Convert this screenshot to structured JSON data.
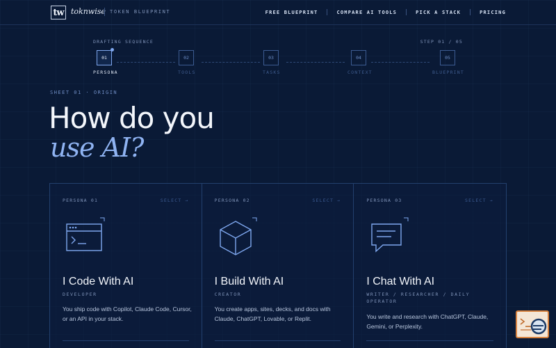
{
  "header": {
    "logo": "tw",
    "brand": "toknwise",
    "subtitle": "TOKEN BLUEPRINT",
    "nav": [
      "FREE BLUEPRINT",
      "COMPARE AI TOOLS",
      "PICK A STACK",
      "PRICING"
    ]
  },
  "stepper": {
    "label": "DRAFTING SEQUENCE",
    "count": "STEP 01 / 05",
    "steps": [
      {
        "num": "01",
        "label": "PERSONA"
      },
      {
        "num": "02",
        "label": "TOOLS"
      },
      {
        "num": "03",
        "label": "TASKS"
      },
      {
        "num": "04",
        "label": "CONTEXT"
      },
      {
        "num": "05",
        "label": "BLUEPRINT"
      }
    ]
  },
  "hero": {
    "sheet": "SHEET 01 · ORIGIN",
    "line1": "How do you",
    "line2": "use AI?"
  },
  "cards": [
    {
      "num": "PERSONA 01",
      "select": "SELECT →",
      "icon": "terminal-window-icon",
      "title": "I Code With AI",
      "role": "DEVELOPER",
      "desc": "You ship code with Copilot, Claude Code, Cursor, or an API in your stack."
    },
    {
      "num": "PERSONA 02",
      "select": "SELECT →",
      "icon": "cube-icon",
      "title": "I Build With AI",
      "role": "CREATOR",
      "desc": "You create apps, sites, decks, and docs with Claude, ChatGPT, Lovable, or Replit."
    },
    {
      "num": "PERSONA 03",
      "select": "SELECT →",
      "icon": "chat-bubble-icon",
      "title": "I Chat With AI",
      "role": "WRITER / RESEARCHER / DAILY OPERATOR",
      "desc": "You write and research with ChatGPT, Claude, Gemini, or Perplexity."
    }
  ],
  "colors": {
    "accent": "#8fb3f2",
    "background": "#0a1a36",
    "fab_border": "#d7823f"
  }
}
